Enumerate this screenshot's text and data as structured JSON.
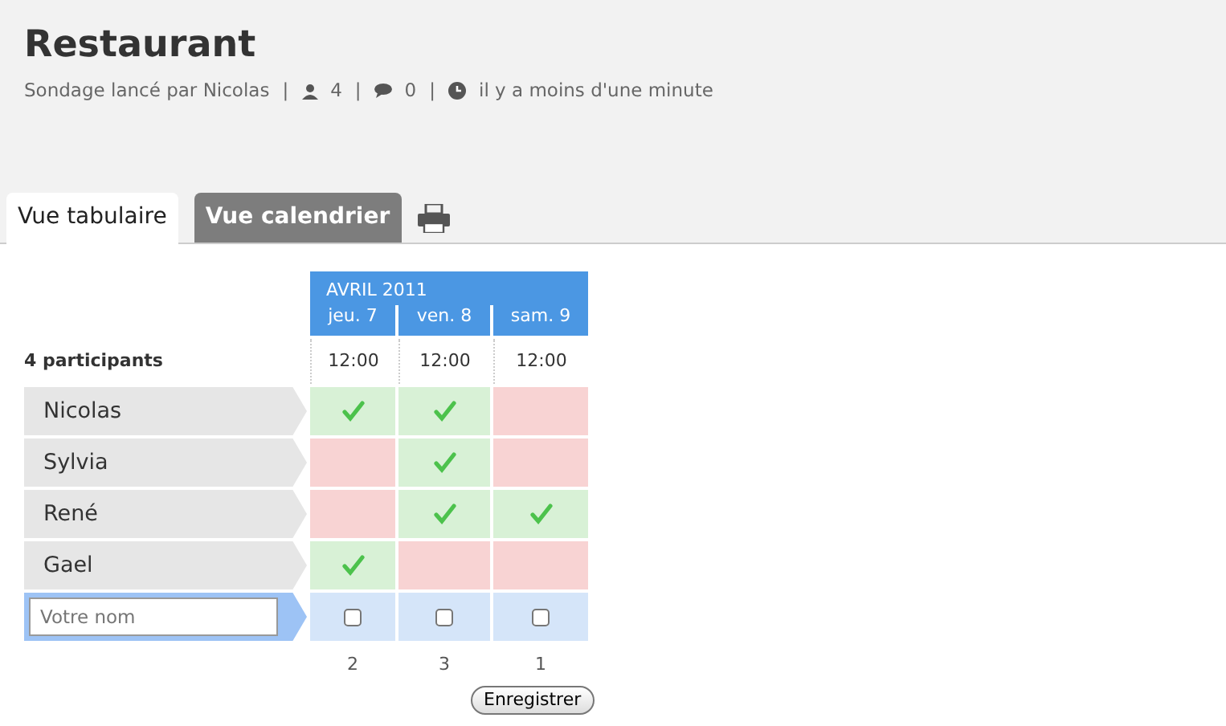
{
  "title": "Restaurant",
  "meta": {
    "author": "Sondage lancé par Nicolas",
    "participants": "4",
    "comments": "0",
    "time": "il y a moins d'une minute",
    "separators": [
      "|",
      "|",
      "|"
    ]
  },
  "tabs": [
    {
      "label": "Vue tabulaire",
      "selected": true
    },
    {
      "label": "Vue calendrier",
      "selected": false
    }
  ],
  "poll": {
    "month": "AVRIL 2011",
    "participants_label": "4 participants",
    "days": [
      {
        "label": "jeu. 7",
        "time": "12:00",
        "total": "2"
      },
      {
        "label": "ven. 8",
        "time": "12:00",
        "total": "3"
      },
      {
        "label": "sam. 9",
        "time": "12:00",
        "total": "1"
      }
    ],
    "rows": [
      {
        "name": "Nicolas",
        "votes": [
          true,
          true,
          false
        ]
      },
      {
        "name": "Sylvia",
        "votes": [
          false,
          true,
          false
        ]
      },
      {
        "name": "René",
        "votes": [
          false,
          true,
          true
        ]
      },
      {
        "name": "Gael",
        "votes": [
          true,
          false,
          false
        ]
      }
    ],
    "new_row": {
      "placeholder": "Votre nom",
      "choices": [
        {
          "checked": false
        },
        {
          "checked": false
        },
        {
          "checked": false
        }
      ]
    },
    "save_button": "Enregistrer"
  }
}
